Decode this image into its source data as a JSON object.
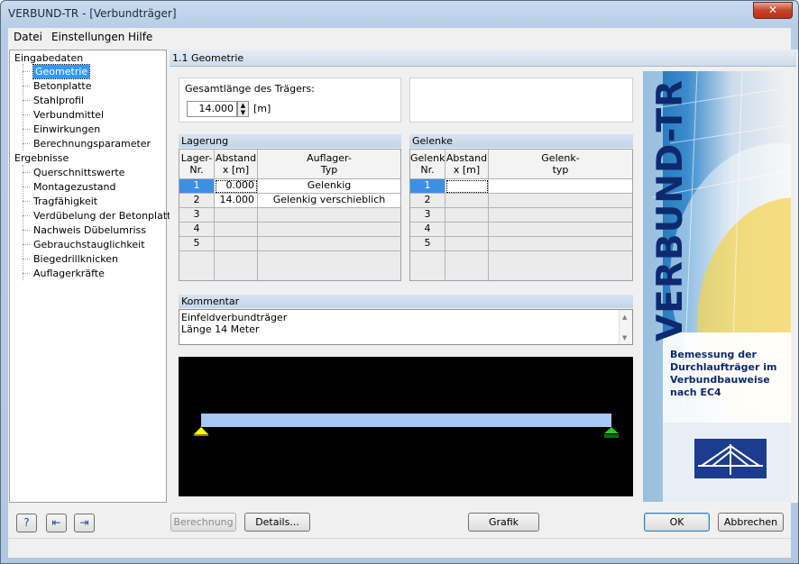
{
  "window": {
    "title": "VERBUND-TR - [Verbundträger]",
    "close_glyph": "✕"
  },
  "menu": {
    "items": [
      "Datei",
      "Einstellungen",
      "Hilfe"
    ]
  },
  "tree": {
    "root1": "Eingabedaten",
    "input_items": [
      "Geometrie",
      "Betonplatte",
      "Stahlprofil",
      "Verbundmittel",
      "Einwirkungen",
      "Berechnungsparameter"
    ],
    "root2": "Ergebnisse",
    "result_items": [
      "Querschnittswerte",
      "Montagezustand",
      "Tragfähigkeit",
      "Verdübelung der Betonplatte",
      "Nachweis Dübelumriss",
      "Gebrauchstauglichkeit",
      "Biegedrillknicken",
      "Auflagerkräfte"
    ],
    "selected": "Geometrie"
  },
  "panel": {
    "title": "1.1 Geometrie"
  },
  "length": {
    "label": "Gesamtlänge des Trägers:",
    "value": "14.000",
    "unit": "[m]"
  },
  "lagerung": {
    "title": "Lagerung",
    "headers": {
      "nr": "Lager-\nNr.",
      "x": "Abstand\nx [m]",
      "typ": "Auflager-\nTyp"
    },
    "rows": [
      {
        "nr": "1",
        "x": "0.000",
        "typ": "Gelenkig"
      },
      {
        "nr": "2",
        "x": "14.000",
        "typ": "Gelenkig verschieblich"
      },
      {
        "nr": "3",
        "x": "",
        "typ": ""
      },
      {
        "nr": "4",
        "x": "",
        "typ": ""
      },
      {
        "nr": "5",
        "x": "",
        "typ": ""
      }
    ]
  },
  "gelenke": {
    "title": "Gelenke",
    "headers": {
      "nr": "Gelenk-\nNr.",
      "x": "Abstand\nx [m]",
      "typ": "Gelenk-\ntyp"
    },
    "rows": [
      {
        "nr": "1",
        "x": "",
        "typ": ""
      },
      {
        "nr": "2",
        "x": "",
        "typ": ""
      },
      {
        "nr": "3",
        "x": "",
        "typ": ""
      },
      {
        "nr": "4",
        "x": "",
        "typ": ""
      },
      {
        "nr": "5",
        "x": "",
        "typ": ""
      }
    ]
  },
  "kommentar": {
    "title": "Kommentar",
    "lines": [
      "Einfeldverbundträger",
      "Länge 14 Meter"
    ]
  },
  "logo": {
    "title": "VERBUND-TR",
    "subtitle": "Bemessung der\nDurchlaufträger im\nVerbundbauweise\nnach EC4"
  },
  "buttons": {
    "berechnung": "Berechnung",
    "details": "Details...",
    "grafik": "Grafik",
    "ok": "OK",
    "abbrechen": "Abbrechen"
  },
  "icons": {
    "help": "help-icon",
    "import": "import-icon",
    "export": "export-icon"
  },
  "colors": {
    "beam": "#a7c8f5",
    "support_left": "#ffff00",
    "support_right": "#22cc22",
    "graphic_bg": "#000000",
    "selection": "#3399ff"
  }
}
